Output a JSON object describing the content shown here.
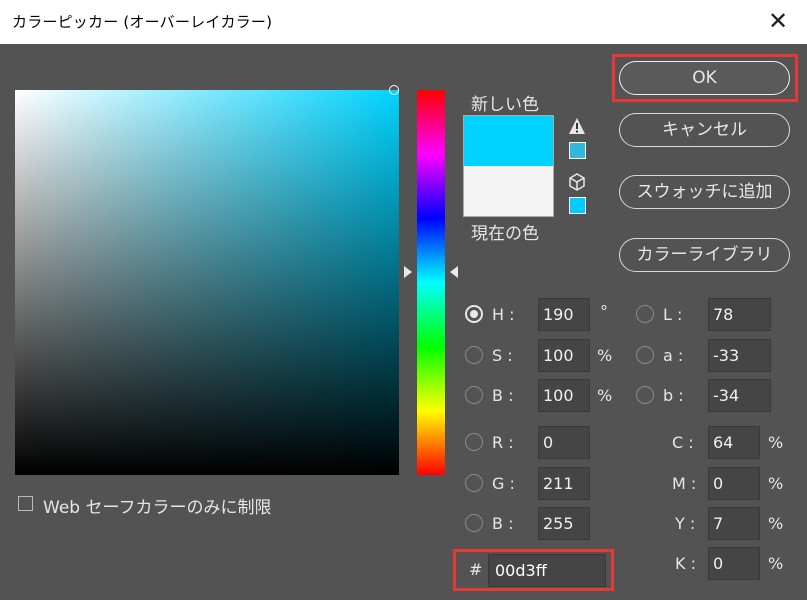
{
  "window": {
    "title": "カラーピッカー (オーバーレイカラー)",
    "close_glyph": "✕"
  },
  "preview": {
    "new_label": "新しい色",
    "current_label": "現在の色",
    "new_color": "#00d3ff",
    "current_color": "#f4f4f4"
  },
  "buttons": {
    "ok": "OK",
    "cancel": "キャンセル",
    "add_swatch": "スウォッチに追加",
    "color_library": "カラーライブラリ"
  },
  "hsb": [
    {
      "label": "H :",
      "value": "190",
      "unit": "°",
      "selected": true
    },
    {
      "label": "S :",
      "value": "100",
      "unit": "%",
      "selected": false
    },
    {
      "label": "B :",
      "value": "100",
      "unit": "%",
      "selected": false
    }
  ],
  "rgb": [
    {
      "label": "R :",
      "value": "0"
    },
    {
      "label": "G :",
      "value": "211"
    },
    {
      "label": "B :",
      "value": "255"
    }
  ],
  "lab": [
    {
      "label": "L :",
      "value": "78"
    },
    {
      "label": "a :",
      "value": "-33"
    },
    {
      "label": "b :",
      "value": "-34"
    }
  ],
  "cmyk": [
    {
      "label": "C :",
      "value": "64",
      "unit": "%"
    },
    {
      "label": "M :",
      "value": "0",
      "unit": "%"
    },
    {
      "label": "Y :",
      "value": "7",
      "unit": "%"
    },
    {
      "label": "K :",
      "value": "0",
      "unit": "%"
    }
  ],
  "hex": {
    "hash": "#",
    "value": "00d3ff"
  },
  "web_safe": {
    "label": "Web セーフカラーのみに制限",
    "checked": false
  },
  "colors": {
    "accent_highlight": "#e53935",
    "background": "#535353"
  }
}
